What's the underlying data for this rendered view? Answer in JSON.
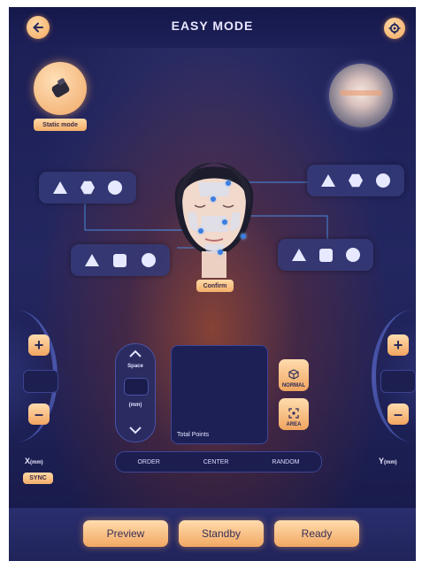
{
  "header": {
    "title": "EASY MODE",
    "back_icon": "arrow-left-icon",
    "settings_icon": "gear-icon"
  },
  "mode": {
    "label": "Static mode",
    "icon": "handpiece-icon"
  },
  "face_area": {
    "confirm_label": "Confirm",
    "groups": [
      {
        "shapes": [
          "triangle",
          "hexagon",
          "circle"
        ]
      },
      {
        "shapes": [
          "triangle",
          "hexagon",
          "circle"
        ]
      },
      {
        "shapes": [
          "triangle",
          "square",
          "circle"
        ]
      },
      {
        "shapes": [
          "triangle",
          "square",
          "circle"
        ]
      }
    ]
  },
  "x_axis": {
    "label": "X",
    "unit": "(mm)",
    "sync_label": "SYNC",
    "value": ""
  },
  "y_axis": {
    "label": "Y",
    "unit": "(mm)",
    "value": ""
  },
  "spacing": {
    "label": "Space",
    "unit": "(mm)",
    "value": ""
  },
  "preview_panel": {
    "total_points_label": "Total Points"
  },
  "mode_buttons": {
    "normal_label": "NORMAL",
    "area_label": "AREA"
  },
  "order_bar": {
    "order": "ORDER",
    "center": "CENTER",
    "random": "RANDOM"
  },
  "actions": {
    "preview": "Preview",
    "standby": "Standby",
    "ready": "Ready"
  },
  "colors": {
    "accent": "#f2a862",
    "background": "#1f2258",
    "dot": "#3a7ee0"
  }
}
